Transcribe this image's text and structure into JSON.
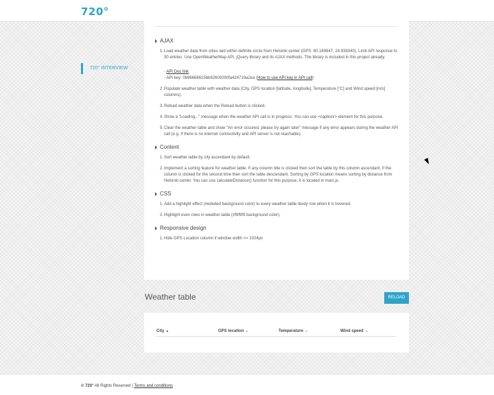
{
  "header": {
    "logo": "720°"
  },
  "sidebar": {
    "items": [
      {
        "label": "720° INTERVIEW"
      }
    ]
  },
  "tasks": {
    "sections": [
      {
        "title": "AJAX",
        "items": [
          {
            "num": "1.",
            "text": "Load weather data from cities laid within definite circle from Helsinki center (GPS: 60.169847, 24.938340). Limit API response to 30 entries. Use OpenWeatherMap API, jQuery library and its AJAX methods. The library is included in this project already.",
            "doc_link": "API Doc link",
            "api_key_prefix": "- API key: 0b96668615bb92609290fa424719a2ea (",
            "api_key_link": "How to use API key in API call",
            "api_key_suffix": ")"
          },
          {
            "num": "2.",
            "text": "Populate weather table with weather data (City, GPS location [latitude, longitude], Temperature [°C] and Wind speed [m/s] columns)."
          },
          {
            "num": "3.",
            "text": "Reload weather data when the Reload button is clicked."
          },
          {
            "num": "4.",
            "text": "Show a \"Loading...\" message when the weather API call is in progress. You can use <caption/> element for this purpose."
          },
          {
            "num": "5.",
            "text": "Clear the weather table and show \"An error occured, please try again later\" message if any error appears during the weather API call (e.g. if there is no internet connectivity and API server is not reachable)."
          }
        ]
      },
      {
        "title": "Content",
        "items": [
          {
            "num": "1.",
            "text": "Sort weather table by city ascendant by default."
          },
          {
            "num": "2.",
            "text": "Implement a sorting feature for weather table. If any column title is clicked then sort the table by this column ascendant. If the column is clicked for the second time then sort the table descendant. Sorting by GPS location means sorting by distance from Helsinki center. You can use calculateDistance() function for this purpose, it is located in main.js."
          }
        ]
      },
      {
        "title": "CSS",
        "items": [
          {
            "num": "1.",
            "text": "Add a highlight effect (#ededed background color) to every weather table tbody row when it is hovered."
          },
          {
            "num": "2.",
            "text": "Highlight even rows in weather table (#f9f9f9 background color)."
          }
        ]
      },
      {
        "title": "Responsive design",
        "items": [
          {
            "num": "1.",
            "text": "Hide GPS Location column if window width <= 1024px"
          }
        ]
      }
    ]
  },
  "weather": {
    "title": "Weather table",
    "reload_label": "RELOAD",
    "columns": [
      {
        "label": "City",
        "sort": "▲"
      },
      {
        "label": "GPS location",
        "sort": "▲"
      },
      {
        "label": "Temperature",
        "sort": "▲"
      },
      {
        "label": "Wind speed",
        "sort": "▲"
      }
    ]
  },
  "footer": {
    "brand": "© 720°",
    "rights": " All Rights Reserved | ",
    "terms": "Terms and conditions"
  },
  "colors": {
    "accent": "#2fa4c9"
  }
}
